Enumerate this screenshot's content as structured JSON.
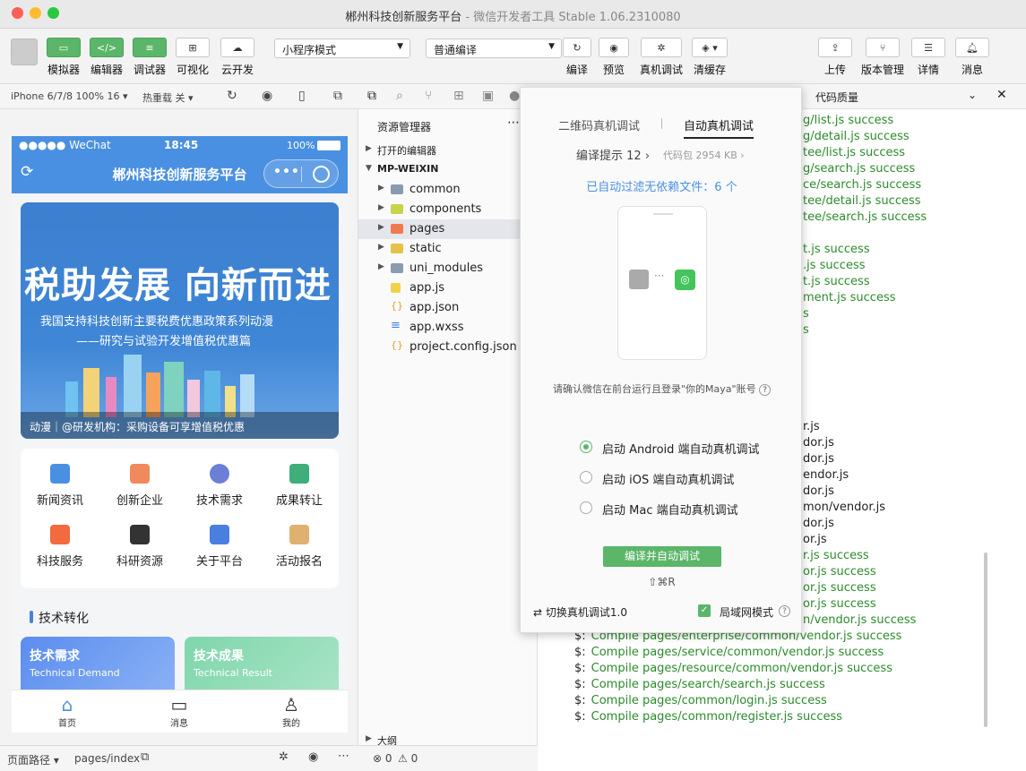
{
  "window": {
    "title": "郴州科技创新服务平台",
    "subtitle": "微信开发者工具 Stable 1.06.2310080"
  },
  "toolbar": {
    "left_buttons": [
      {
        "label": "模拟器"
      },
      {
        "label": "编辑器"
      },
      {
        "label": "调试器"
      },
      {
        "label": "可视化"
      },
      {
        "label": "云开发"
      }
    ],
    "mode_select": "小程序模式",
    "compile_select": "普通编译",
    "mid_buttons": [
      {
        "label": "编译"
      },
      {
        "label": "预览"
      },
      {
        "label": "真机调试"
      },
      {
        "label": "清缓存"
      }
    ],
    "right_buttons": [
      {
        "label": "上传"
      },
      {
        "label": "版本管理"
      },
      {
        "label": "详情"
      },
      {
        "label": "消息"
      }
    ]
  },
  "simulator": {
    "device": "iPhone 6/7/8 100% 16",
    "hot_reload": "热重载 关",
    "status": {
      "carrier": "●●●●● WeChat",
      "time": "18:45",
      "battery": "100%"
    },
    "nav_title": "郴州科技创新服务平台",
    "banner": {
      "headline": "税助发展 向新而进",
      "line2": "我国支持科技创新主要税费优惠政策系列动漫",
      "line3": "——研究与试验开发增值税优惠篇",
      "caption": "动漫｜@研发机构：采购设备可享增值税优惠"
    },
    "grid_items": [
      {
        "label": "新闻资讯",
        "color": "#4a90e2"
      },
      {
        "label": "创新企业",
        "color": "#f08a5d"
      },
      {
        "label": "技术需求",
        "color": "#6b7fd7"
      },
      {
        "label": "成果转让",
        "color": "#3fae7a"
      },
      {
        "label": "科技服务",
        "color": "#f26a3d"
      },
      {
        "label": "科研资源",
        "color": "#333333"
      },
      {
        "label": "关于平台",
        "color": "#4a7fe0"
      },
      {
        "label": "活动报名",
        "color": "#e0b070"
      }
    ],
    "section_title": "技术转化",
    "cards": [
      {
        "title": "技术需求",
        "subtitle": "Technical Demand"
      },
      {
        "title": "技术成果",
        "subtitle": "Technical Result"
      }
    ],
    "tabs": [
      {
        "label": "首页"
      },
      {
        "label": "消息"
      },
      {
        "label": "我的"
      }
    ],
    "footer": {
      "path_label": "页面路径",
      "path": "pages/index"
    }
  },
  "explorer": {
    "title": "资源管理器",
    "open_editors": "打开的编辑器",
    "project": "MP-WEIXIN",
    "tree": [
      {
        "name": "common",
        "kind": "folder"
      },
      {
        "name": "components",
        "kind": "folder"
      },
      {
        "name": "pages",
        "kind": "folder"
      },
      {
        "name": "static",
        "kind": "folder"
      },
      {
        "name": "uni_modules",
        "kind": "folder"
      },
      {
        "name": "app.js",
        "kind": "js"
      },
      {
        "name": "app.json",
        "kind": "json"
      },
      {
        "name": "app.wxss",
        "kind": "wxss"
      },
      {
        "name": "project.config.json",
        "kind": "json"
      }
    ],
    "outline": "大纲",
    "errors": "0",
    "warnings": "0"
  },
  "right_panel": {
    "tab": "代码质量"
  },
  "console_lines": [
    "g/list.js success",
    "g/detail.js success",
    "tee/list.js success",
    "g/search.js success",
    "ce/search.js success",
    "tee/detail.js success",
    "tee/search.js success",
    "t.js success",
    ".js success",
    "t.js success",
    "ment.js success",
    "s",
    "s",
    "r.js",
    "dor.js",
    "dor.js",
    "endor.js",
    "dor.js",
    "mon/vendor.js",
    "dor.js",
    "or.js",
    "r.js success",
    "or.js success",
    "or.js success",
    "or.js success",
    "n/vendor.js success",
    "Compile pages/enterprise/common/vendor.js success",
    "Compile pages/service/common/vendor.js success",
    "Compile pages/resource/common/vendor.js success",
    "Compile pages/search/search.js success",
    "Compile pages/common/login.js success",
    "Compile pages/common/register.js success"
  ],
  "popup": {
    "tab_qr": "二维码真机调试",
    "tab_auto": "自动真机调试",
    "compile_tip": "编译提示 12",
    "code_pkg": "代码包 2954 KB",
    "filtered": "已自动过滤无依赖文件：6 个",
    "confirm": "请确认微信在前台运行且登录\"你的Maya\"账号",
    "options": [
      {
        "label": "启动 Android 端自动真机调试",
        "selected": true
      },
      {
        "label": "启动 iOS 端自动真机调试",
        "selected": false
      },
      {
        "label": "启动 Mac 端自动真机调试",
        "selected": false
      }
    ],
    "action": "编译并自动调试",
    "shortcut": "⇧⌘R",
    "switch": "切换真机调试1.0",
    "lan_mode": "局域网模式"
  }
}
